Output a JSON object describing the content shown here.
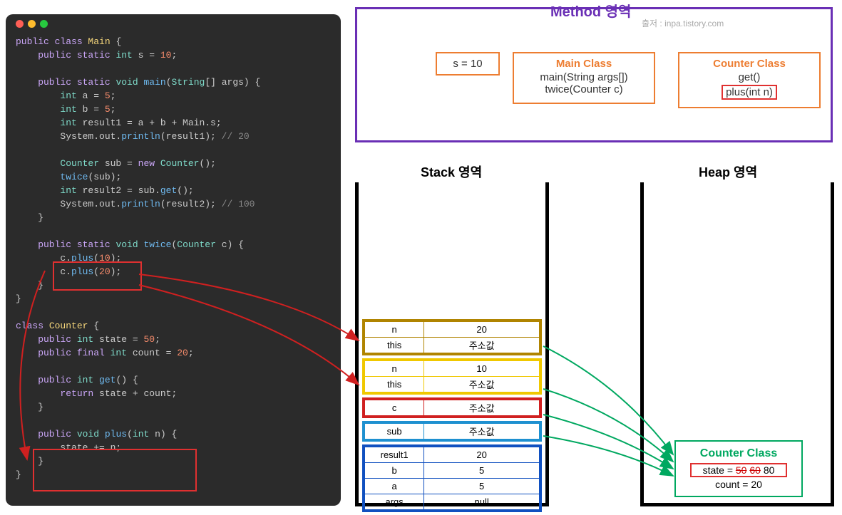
{
  "code": {
    "lines": [
      {
        "t": "public class ",
        "k": "kw",
        "r": [
          {
            "t": "Main",
            "k": "cls"
          },
          {
            "t": " {",
            "k": ""
          }
        ]
      },
      {
        "t": "    public static ",
        "k": "kw",
        "r": [
          {
            "t": "int",
            "k": "ty"
          },
          {
            "t": " s = ",
            "k": ""
          },
          {
            "t": "10",
            "k": "num"
          },
          {
            "t": ";",
            "k": ""
          }
        ]
      },
      {
        "t": "",
        "k": ""
      },
      {
        "t": "    public static ",
        "k": "kw",
        "r": [
          {
            "t": "void",
            "k": "ty"
          },
          {
            "t": " ",
            "k": ""
          },
          {
            "t": "main",
            "k": "fn"
          },
          {
            "t": "(",
            "k": ""
          },
          {
            "t": "String",
            "k": "ty"
          },
          {
            "t": "[] args) {",
            "k": ""
          }
        ]
      },
      {
        "t": "        ",
        "k": "",
        "r": [
          {
            "t": "int",
            "k": "ty"
          },
          {
            "t": " a = ",
            "k": ""
          },
          {
            "t": "5",
            "k": "num"
          },
          {
            "t": ";",
            "k": ""
          }
        ]
      },
      {
        "t": "        ",
        "k": "",
        "r": [
          {
            "t": "int",
            "k": "ty"
          },
          {
            "t": " b = ",
            "k": ""
          },
          {
            "t": "5",
            "k": "num"
          },
          {
            "t": ";",
            "k": ""
          }
        ]
      },
      {
        "t": "        ",
        "k": "",
        "r": [
          {
            "t": "int",
            "k": "ty"
          },
          {
            "t": " result1 = a + b + Main.s;",
            "k": ""
          }
        ]
      },
      {
        "t": "        System.out.",
        "k": "",
        "r": [
          {
            "t": "println",
            "k": "fn"
          },
          {
            "t": "(result1); ",
            "k": ""
          },
          {
            "t": "// 20",
            "k": "cm"
          }
        ]
      },
      {
        "t": "",
        "k": ""
      },
      {
        "t": "        ",
        "k": "",
        "r": [
          {
            "t": "Counter",
            "k": "ty"
          },
          {
            "t": " sub = ",
            "k": ""
          },
          {
            "t": "new",
            "k": "kw"
          },
          {
            "t": " ",
            "k": ""
          },
          {
            "t": "Counter",
            "k": "ty"
          },
          {
            "t": "();",
            "k": ""
          }
        ]
      },
      {
        "t": "        ",
        "k": "",
        "r": [
          {
            "t": "twice",
            "k": "fn"
          },
          {
            "t": "(sub);",
            "k": ""
          }
        ]
      },
      {
        "t": "        ",
        "k": "",
        "r": [
          {
            "t": "int",
            "k": "ty"
          },
          {
            "t": " result2 = sub.",
            "k": ""
          },
          {
            "t": "get",
            "k": "fn"
          },
          {
            "t": "();",
            "k": ""
          }
        ]
      },
      {
        "t": "        System.out.",
        "k": "",
        "r": [
          {
            "t": "println",
            "k": "fn"
          },
          {
            "t": "(result2); ",
            "k": ""
          },
          {
            "t": "// 100",
            "k": "cm"
          }
        ]
      },
      {
        "t": "    }",
        "k": ""
      },
      {
        "t": "",
        "k": ""
      },
      {
        "t": "    public static ",
        "k": "kw",
        "r": [
          {
            "t": "void",
            "k": "ty"
          },
          {
            "t": " ",
            "k": ""
          },
          {
            "t": "twice",
            "k": "fn"
          },
          {
            "t": "(",
            "k": ""
          },
          {
            "t": "Counter",
            "k": "ty"
          },
          {
            "t": " c) {",
            "k": ""
          }
        ]
      },
      {
        "t": "        c.",
        "k": "",
        "r": [
          {
            "t": "plus",
            "k": "fn"
          },
          {
            "t": "(",
            "k": ""
          },
          {
            "t": "10",
            "k": "num"
          },
          {
            "t": ");",
            "k": ""
          }
        ]
      },
      {
        "t": "        c.",
        "k": "",
        "r": [
          {
            "t": "plus",
            "k": "fn"
          },
          {
            "t": "(",
            "k": ""
          },
          {
            "t": "20",
            "k": "num"
          },
          {
            "t": ");",
            "k": ""
          }
        ]
      },
      {
        "t": "    }",
        "k": ""
      },
      {
        "t": "}",
        "k": ""
      },
      {
        "t": "",
        "k": ""
      },
      {
        "t": "class ",
        "k": "kw",
        "r": [
          {
            "t": "Counter",
            "k": "cls"
          },
          {
            "t": " {",
            "k": ""
          }
        ]
      },
      {
        "t": "    public ",
        "k": "kw",
        "r": [
          {
            "t": "int",
            "k": "ty"
          },
          {
            "t": " state = ",
            "k": ""
          },
          {
            "t": "50",
            "k": "num"
          },
          {
            "t": ";",
            "k": ""
          }
        ]
      },
      {
        "t": "    public final ",
        "k": "kw",
        "r": [
          {
            "t": "int",
            "k": "ty"
          },
          {
            "t": " count = ",
            "k": ""
          },
          {
            "t": "20",
            "k": "num"
          },
          {
            "t": ";",
            "k": ""
          }
        ]
      },
      {
        "t": "",
        "k": ""
      },
      {
        "t": "    public ",
        "k": "kw",
        "r": [
          {
            "t": "int",
            "k": "ty"
          },
          {
            "t": " ",
            "k": ""
          },
          {
            "t": "get",
            "k": "fn"
          },
          {
            "t": "() {",
            "k": ""
          }
        ]
      },
      {
        "t": "        ",
        "k": "",
        "r": [
          {
            "t": "return",
            "k": "kw"
          },
          {
            "t": " state + count;",
            "k": ""
          }
        ]
      },
      {
        "t": "    }",
        "k": ""
      },
      {
        "t": "",
        "k": ""
      },
      {
        "t": "    public ",
        "k": "kw",
        "r": [
          {
            "t": "void",
            "k": "ty"
          },
          {
            "t": " ",
            "k": ""
          },
          {
            "t": "plus",
            "k": "fn"
          },
          {
            "t": "(",
            "k": ""
          },
          {
            "t": "int",
            "k": "ty"
          },
          {
            "t": " n) {",
            "k": ""
          }
        ]
      },
      {
        "t": "        state += n;",
        "k": ""
      },
      {
        "t": "    }",
        "k": ""
      },
      {
        "t": "}",
        "k": ""
      }
    ]
  },
  "method": {
    "title": "Method 영역",
    "source": "출저 : inpa.tistory.com",
    "sbox": "s = 10",
    "main": {
      "hdr": "Main Class",
      "l1": "main(String args[])",
      "l2": "twice(Counter c)"
    },
    "counter": {
      "hdr": "Counter Class",
      "l1": "get()",
      "l2": "plus(int n)"
    }
  },
  "stack": {
    "title": "Stack 영역",
    "frames": [
      {
        "cls": "f-olive",
        "rows": [
          [
            "n",
            "20"
          ],
          [
            "this",
            "주소값"
          ]
        ]
      },
      {
        "cls": "f-yellow",
        "rows": [
          [
            "n",
            "10"
          ],
          [
            "this",
            "주소값"
          ]
        ]
      },
      {
        "cls": "f-red",
        "rows": [
          [
            "c",
            "주소값"
          ]
        ]
      },
      {
        "cls": "f-cyan",
        "rows": [
          [
            "sub",
            "주소값"
          ]
        ]
      },
      {
        "cls": "f-blue",
        "rows": [
          [
            "result1",
            "20"
          ],
          [
            "b",
            "5"
          ],
          [
            "a",
            "5"
          ],
          [
            "args",
            "null"
          ]
        ]
      }
    ]
  },
  "heap": {
    "title": "Heap 영역",
    "box": {
      "hdr": "Counter Class",
      "label": "state = ",
      "s1": "50",
      "s2": "60",
      "s3": "80",
      "count": "count = 20"
    }
  }
}
